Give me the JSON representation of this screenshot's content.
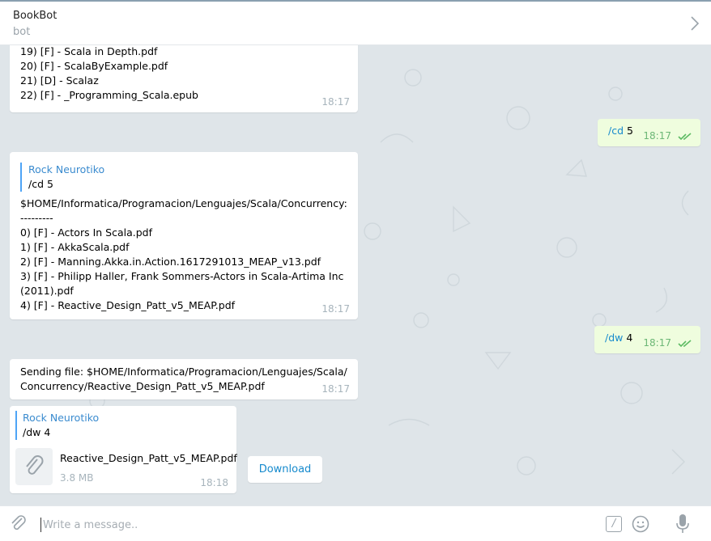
{
  "header": {
    "title": "BookBot",
    "subtitle": "bot"
  },
  "messages": {
    "m1": {
      "lines": [
        "19) [F] - Scala in Depth.pdf",
        "20) [F] - ScalaByExample.pdf",
        "21) [D] - Scalaz",
        "22) [F] - _Programming_Scala.epub"
      ],
      "time": "18:17"
    },
    "m2": {
      "cmd": "/cd",
      "arg": "5",
      "time": "18:17"
    },
    "m3": {
      "reply_name": "Rock Neurotiko",
      "reply_text": "/cd 5",
      "lines": [
        "$HOME/Informatica/Programacion/Lenguajes/Scala/Concurrency:",
        "---------",
        "0) [F] - Actors In Scala.pdf",
        "1) [F] - AkkaScala.pdf",
        "2) [F] - Manning.Akka.in.Action.1617291013_MEAP_v13.pdf",
        "3) [F] - Philipp Haller, Frank Sommers-Actors in Scala-Artima Inc",
        "(2011).pdf",
        "4) [F] - Reactive_Design_Patt_v5_MEAP.pdf"
      ],
      "time": "18:17"
    },
    "m4": {
      "cmd": "/dw",
      "arg": "4",
      "time": "18:17"
    },
    "m5": {
      "lines": [
        "Sending file: $HOME/Informatica/Programacion/Lenguajes/Scala/",
        "Concurrency/Reactive_Design_Patt_v5_MEAP.pdf"
      ],
      "time": "18:17"
    },
    "m6": {
      "reply_name": "Rock Neurotiko",
      "reply_text": "/dw 4",
      "file_name": "Reactive_Design_Patt_v5_MEAP.pdf",
      "file_size": "3.8 MB",
      "time": "18:18",
      "download_label": "Download"
    }
  },
  "composer": {
    "placeholder": "Write a message..",
    "bot_command_glyph": "/"
  },
  "icons": {
    "forward": "chevron-right-icon",
    "read_receipt": "double-check-icon",
    "attach": "paperclip-icon",
    "emoji": "smiley-icon",
    "voice": "microphone-icon"
  },
  "colors": {
    "link": "#168acd",
    "outgoing_bubble": "#effdde",
    "incoming_bubble": "#ffffff",
    "accent": "#4ea4f6"
  }
}
